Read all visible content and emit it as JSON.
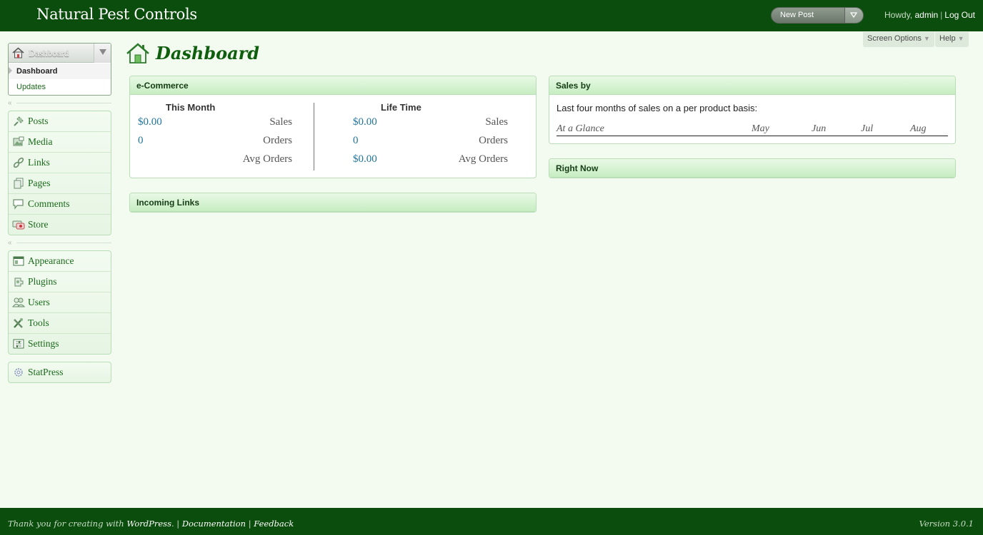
{
  "header": {
    "site_title": "Natural Pest Controls",
    "favorite_action": "New Post",
    "howdy": "Howdy,",
    "username": "admin",
    "logout": "Log Out"
  },
  "screen_meta": {
    "screen_options": "Screen Options",
    "help": "Help"
  },
  "menu": {
    "dashboard_label": "Dashboard",
    "dashboard_sub": [
      "Dashboard",
      "Updates"
    ],
    "group1": [
      "Posts",
      "Media",
      "Links",
      "Pages",
      "Comments",
      "Store"
    ],
    "group2": [
      "Appearance",
      "Plugins",
      "Users",
      "Tools",
      "Settings"
    ],
    "group3": [
      "StatPress"
    ]
  },
  "page": {
    "title": "Dashboard"
  },
  "ecommerce": {
    "title": "e-Commerce",
    "this_month": {
      "heading": "This Month",
      "sales": "$0.00",
      "orders": "0"
    },
    "life_time": {
      "heading": "Life Time",
      "sales": "$0.00",
      "orders": "0",
      "avg_orders": "$0.00"
    },
    "labels": {
      "sales": "Sales",
      "orders": "Orders",
      "avg_orders": "Avg Orders"
    }
  },
  "incoming_links": {
    "title": "Incoming Links"
  },
  "sales_by": {
    "title": "Sales by",
    "description": "Last four months of sales on a per product basis:",
    "columns": [
      "At a Glance",
      "May",
      "Jun",
      "Jul",
      "Aug"
    ]
  },
  "right_now": {
    "title": "Right Now"
  },
  "footer": {
    "thanks": "Thank you for creating with",
    "wordpress": "WordPress",
    "documentation": "Documentation",
    "feedback": "Feedback",
    "version": "Version 3.0.1"
  },
  "colors": {
    "header_bg": "#0b4d0c",
    "link": "#21759b",
    "menu_text": "#1b6a1b"
  }
}
